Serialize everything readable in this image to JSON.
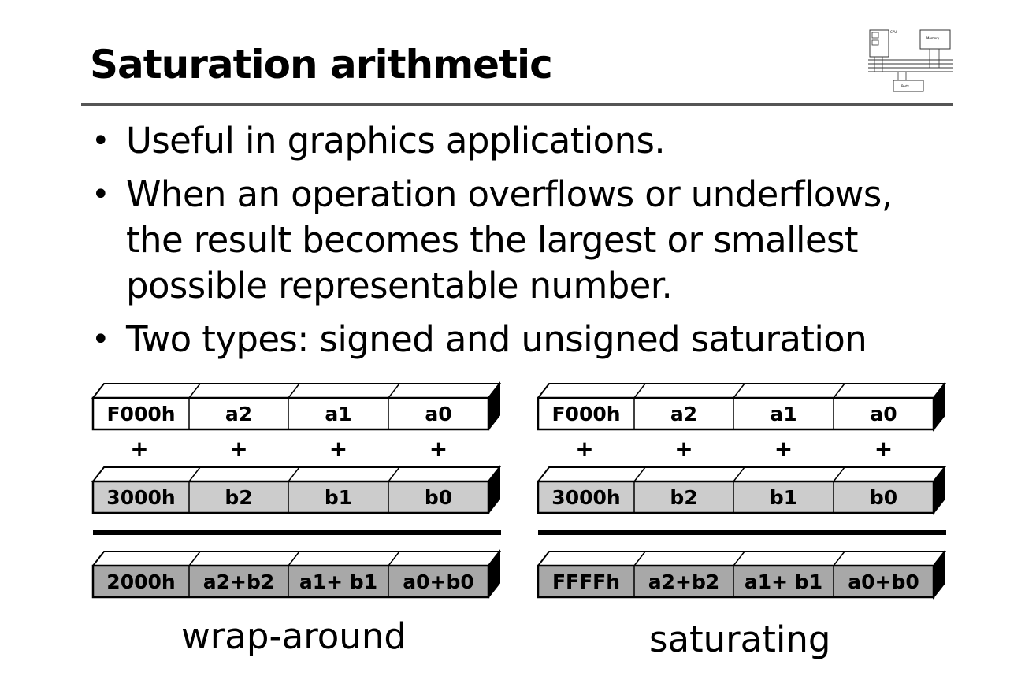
{
  "slide": {
    "title": "Saturation arithmetic",
    "bullets": [
      "Useful in graphics applications.",
      "When an operation overflows or underflows, the result becomes the largest or smallest possible representable number.",
      "Two types: signed and unsigned saturation"
    ],
    "bullet_glyph": "•"
  },
  "logo": {
    "labels": [
      "CPU",
      "Memory",
      "Ports"
    ]
  },
  "diagrams": [
    {
      "caption": "wrap-around",
      "operator": "+",
      "rows": [
        {
          "cells": [
            "F000h",
            "a2",
            "a1",
            "a0"
          ],
          "fill": "#ffffff"
        },
        {
          "cells": [
            "3000h",
            "b2",
            "b1",
            "b0"
          ],
          "fill": "#cccccc"
        },
        {
          "cells": [
            "2000h",
            "a2+b2",
            "a1+ b1",
            "a0+b0"
          ],
          "fill": "#a8a8a8"
        }
      ]
    },
    {
      "caption": "saturating",
      "operator": "+",
      "rows": [
        {
          "cells": [
            "F000h",
            "a2",
            "a1",
            "a0"
          ],
          "fill": "#ffffff"
        },
        {
          "cells": [
            "3000h",
            "b2",
            "b1",
            "b0"
          ],
          "fill": "#cccccc"
        },
        {
          "cells": [
            "FFFFh",
            "a2+b2",
            "a1+ b1",
            "a0+b0"
          ],
          "fill": "#a8a8a8"
        }
      ]
    }
  ]
}
